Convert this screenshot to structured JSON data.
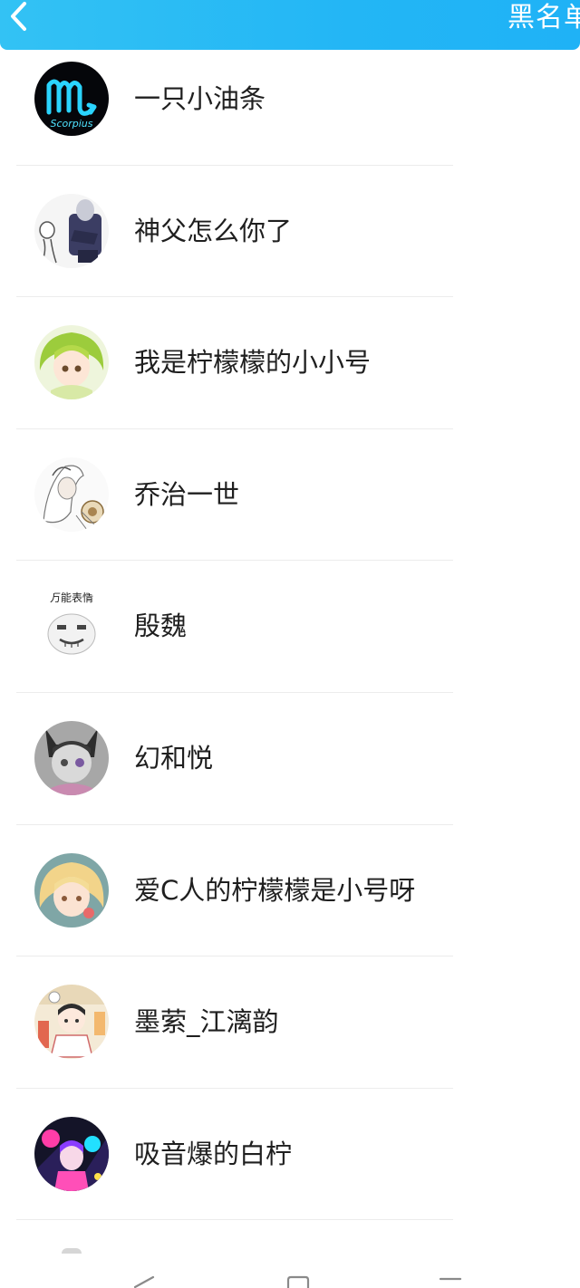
{
  "header": {
    "title": "黑名单",
    "back_icon": "chevron-left-icon",
    "background": "#23b6f5"
  },
  "blacklist": [
    {
      "name": "一只小油条"
    },
    {
      "name": "神父怎么你了"
    },
    {
      "name": "我是柠檬檬的小小号"
    },
    {
      "name": "乔治一世"
    },
    {
      "name": "殷魏"
    },
    {
      "name": "幻和悦"
    },
    {
      "name": "爱C人的柠檬檬是小号呀"
    },
    {
      "name": "墨萦_江漓韵"
    },
    {
      "name": "吸音爆的白柠"
    }
  ],
  "avatar_texts": {
    "scorpius": "Scorpius",
    "sticker_caption": "万能表情"
  },
  "navbar": {
    "back": "triangle-back-icon",
    "home": "square-home-icon",
    "menu": "hamburger-menu-icon"
  }
}
